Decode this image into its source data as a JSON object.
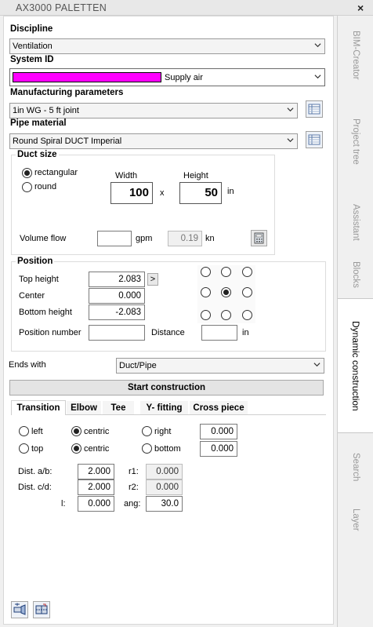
{
  "titlebar": {
    "title": "AX3000 PALETTEN",
    "close": "×"
  },
  "side_tabs": [
    {
      "label": "BIM-Creator",
      "active": false
    },
    {
      "label": "Project tree",
      "active": false
    },
    {
      "label": "Assistant",
      "active": false
    },
    {
      "label": "Blocks",
      "active": false
    },
    {
      "label": "Dynamic construction",
      "active": true
    },
    {
      "label": "Search",
      "active": false
    },
    {
      "label": "Layer",
      "active": false
    }
  ],
  "discipline": {
    "label": "Discipline",
    "value": "Ventilation"
  },
  "system_id": {
    "label": "System ID",
    "value": "Supply air",
    "color": "#ff00ff"
  },
  "manufacturing": {
    "label": "Manufacturing parameters",
    "value": "1in WG - 5 ft joint"
  },
  "pipe_material": {
    "label": "Pipe material",
    "value": "Round Spiral DUCT Imperial"
  },
  "duct_size": {
    "title": "Duct size",
    "rect_label": "rectangular",
    "round_label": "round",
    "width_label": "Width",
    "height_label": "Height",
    "width_value": "100",
    "height_value": "50",
    "x_sep": "x",
    "unit": "in",
    "volume_label": "Volume flow",
    "volume_value": "",
    "volume_unit": "gpm",
    "velocity_value": "0.19",
    "velocity_unit": "kn"
  },
  "position": {
    "title": "Position",
    "top_label": "Top height",
    "top_value": "2.083",
    "center_label": "Center",
    "center_value": "0.000",
    "bottom_label": "Bottom height",
    "bottom_value": "-2.083",
    "arrow": ">",
    "posnum_label": "Position number",
    "posnum_value": "",
    "distance_label": "Distance",
    "distance_value": "",
    "distance_unit": "in"
  },
  "ends_with": {
    "label": "Ends with",
    "value": "Duct/Pipe"
  },
  "start_button": "Start construction",
  "tabs": [
    "Transition",
    "Elbow",
    "Tee",
    "Y- fitting",
    "Cross piece"
  ],
  "transition": {
    "left": "left",
    "centric1": "centric",
    "right": "right",
    "h_value": "0.000",
    "top": "top",
    "centric2": "centric",
    "bottom": "bottom",
    "v_value": "0.000",
    "dist_ab_label": "Dist. a/b:",
    "dist_ab": "2.000",
    "r1_label": "r1:",
    "r1": "0.000",
    "dist_cd_label": "Dist. c/d:",
    "dist_cd": "2.000",
    "r2_label": "r2:",
    "r2": "0.000",
    "l_label": "l:",
    "l": "0.000",
    "ang_label": "ang:",
    "ang": "30.0"
  }
}
